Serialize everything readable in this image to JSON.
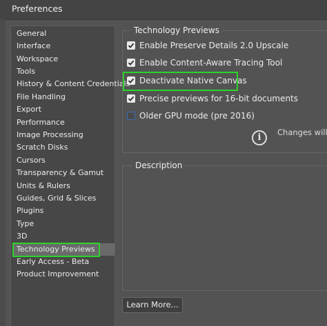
{
  "window": {
    "title": "Preferences"
  },
  "sidebar": {
    "items": [
      {
        "label": "General"
      },
      {
        "label": "Interface"
      },
      {
        "label": "Workspace"
      },
      {
        "label": "Tools"
      },
      {
        "label": "History & Content Credentials"
      },
      {
        "label": "File Handling"
      },
      {
        "label": "Export"
      },
      {
        "label": "Performance"
      },
      {
        "label": "Image Processing"
      },
      {
        "label": "Scratch Disks"
      },
      {
        "label": "Cursors"
      },
      {
        "label": "Transparency & Gamut"
      },
      {
        "label": "Units & Rulers"
      },
      {
        "label": "Guides, Grid & Slices"
      },
      {
        "label": "Plugins"
      },
      {
        "label": "Type"
      },
      {
        "label": "3D"
      },
      {
        "label": "Technology Previews",
        "selected": true
      },
      {
        "label": "Early Access - Beta"
      },
      {
        "label": "Product Improvement"
      }
    ]
  },
  "tech_previews": {
    "heading": "Technology Previews",
    "options": [
      {
        "label": "Enable Preserve Details 2.0 Upscale",
        "checked": true
      },
      {
        "label": "Enable Content-Aware Tracing Tool",
        "checked": true
      },
      {
        "label": "Deactivate Native Canvas",
        "checked": true
      },
      {
        "label": "Precise previews for 16-bit documents",
        "checked": true
      },
      {
        "label": "Older GPU mode (pre 2016)",
        "checked": false
      }
    ],
    "info_icon": "info-icon",
    "info_text": "Changes will t"
  },
  "description": {
    "heading": "Description"
  },
  "buttons": {
    "learn_more": "Learn More..."
  },
  "colors": {
    "highlight": "#2bd42b",
    "background": "#535353",
    "selected_item": "#6a6a6a"
  }
}
